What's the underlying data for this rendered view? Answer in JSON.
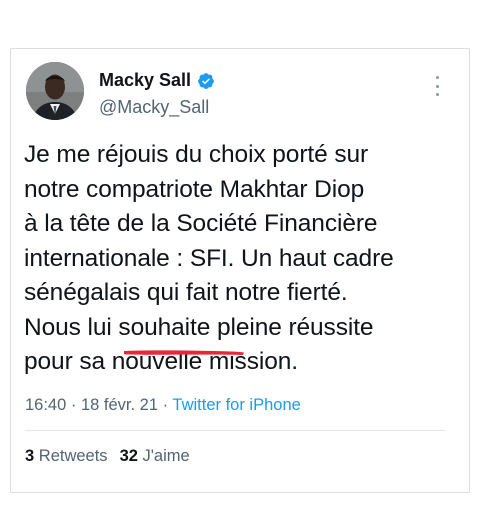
{
  "author": {
    "name": "Macky Sall",
    "handle": "@Macky_Sall",
    "verified_icon": "verified-badge-icon",
    "avatar_icon": "profile-avatar"
  },
  "tweet": {
    "lines": [
      "Je me réjouis du choix porté sur",
      "notre compatriote Makhtar Diop",
      "à la tête de la Société Financière",
      "internationale : SFI. Un haut cadre",
      "sénégalais qui fait notre fierté.",
      "Nous lui souhaite pleine réussite",
      "pour sa nouvelle mission."
    ]
  },
  "meta": {
    "time": "16:40",
    "separator1": " · ",
    "date": "18 févr. 21",
    "separator2": " · ",
    "source": "Twitter for iPhone"
  },
  "stats": {
    "retweets_count": "3",
    "retweets_label": "Retweets",
    "likes_count": "32",
    "likes_label": "J'aime"
  },
  "colors": {
    "accent": "#1d9bf0",
    "annotation_red": "#e8283a",
    "secondary_text": "#536471"
  }
}
